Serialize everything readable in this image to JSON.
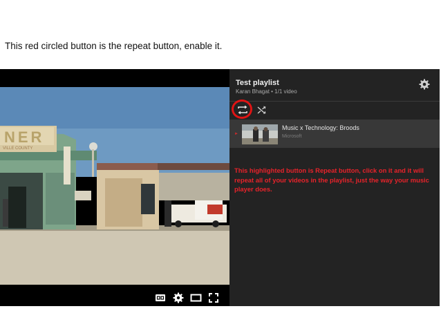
{
  "caption": "This red circled button is the repeat button, enable it.",
  "playlist": {
    "title": "Test playlist",
    "subtitle": "Karan Bhagat • 1/1 video",
    "items": [
      {
        "title": "Music x Technology: Broods",
        "channel": "Microsoft"
      }
    ]
  },
  "note": "This highlighted button is Repeat button, click on it and it will repeat all of your videos in the playlist, just the way your music player does.",
  "video": {
    "sign_text": "NER",
    "sign_subtext": "VILLE COUNTY"
  },
  "icons": {
    "repeat": "repeat-icon",
    "shuffle": "shuffle-icon",
    "settings": "gear-icon",
    "captions": "cc-icon",
    "theater": "theater-icon",
    "fullscreen": "fullscreen-icon"
  },
  "colors": {
    "highlight": "#e01414",
    "panel_bg": "#232323",
    "note_text": "#e8232a"
  }
}
